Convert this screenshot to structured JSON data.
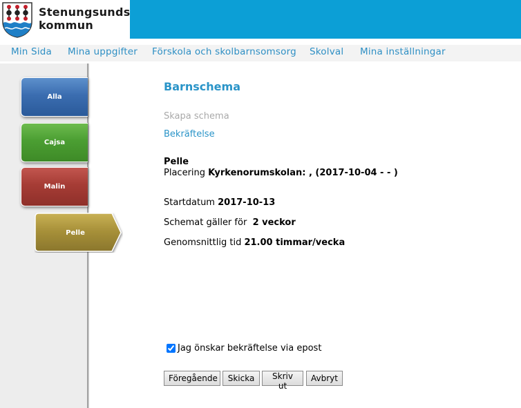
{
  "header": {
    "logo_line1": "Stenungsunds",
    "logo_line2": "kommun",
    "band_color": "#0c9fd6",
    "logo_icon": "coat-of-arms-icon"
  },
  "nav": {
    "items": [
      "Min Sida",
      "Mina uppgifter",
      "Förskola och skolbarnsomsorg",
      "Skolval",
      "Mina inställningar"
    ]
  },
  "children_tabs": [
    {
      "label": "Alla",
      "color": "#3b6db0"
    },
    {
      "label": "Cajsa",
      "color": "#4b9e32"
    },
    {
      "label": "Malin",
      "color": "#a63c35"
    },
    {
      "label": "Pelle",
      "color": "#a8913a",
      "active": true
    }
  ],
  "main": {
    "title": "Barnschema",
    "step_create": "Skapa schema",
    "step_confirm": "Bekräftelse",
    "child_name": "Pelle",
    "placement_label": "Placering",
    "placement_value": "Kyrkenorumskolan: , (2017-10-04 - - )",
    "start_label": "Startdatum",
    "start_value": "2017-10-13",
    "valid_label": "Schemat gäller för",
    "valid_value": "2 veckor",
    "avg_label": "Genomsnittlig tid",
    "avg_value": "21.00 timmar/vecka",
    "email_confirm_label": "Jag önskar bekräftelse via epost",
    "email_confirm_checked": true
  },
  "buttons": {
    "previous": "Föregående",
    "send": "Skicka",
    "print": "Skriv ut",
    "cancel": "Avbryt"
  }
}
